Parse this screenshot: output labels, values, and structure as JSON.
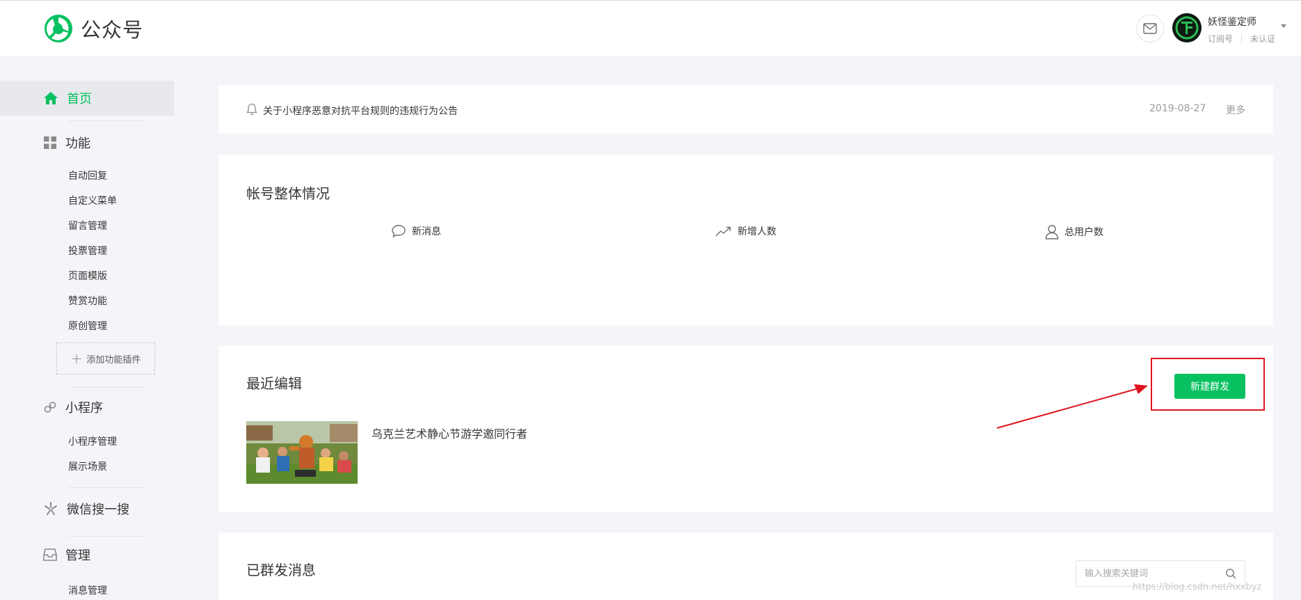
{
  "header": {
    "brand": "公众号",
    "account_name": "妖怪鉴定师",
    "account_type": "订阅号",
    "account_status": "未认证",
    "icons": [
      "brand-logo-icon",
      "mail-icon",
      "avatar",
      "chevron-down-icon"
    ]
  },
  "sidebar": {
    "home": "首页",
    "functions": {
      "label": "功能",
      "items": [
        "自动回复",
        "自定义菜单",
        "留言管理",
        "投票管理",
        "页面模版",
        "赞赏功能",
        "原创管理"
      ]
    },
    "add_plugin": "添加功能插件",
    "miniprogram": {
      "label": "小程序",
      "items": [
        "小程序管理",
        "展示场景"
      ]
    },
    "wechat_search": {
      "label": "微信搜一搜"
    },
    "management": {
      "label": "管理",
      "items": [
        "消息管理"
      ]
    }
  },
  "notice": {
    "text": "关于小程序恶意对抗平台规则的违规行为公告",
    "date": "2019-08-27",
    "more": "更多"
  },
  "overview": {
    "title": "帐号整体情况",
    "stats": [
      "新消息",
      "新增人数",
      "总用户数"
    ]
  },
  "recent": {
    "title": "最近编辑",
    "new_button": "新建群发",
    "article_title": "乌克兰艺术静心节游学邀同行者"
  },
  "sent": {
    "title": "已群发消息",
    "search_placeholder": "输入搜索关键词"
  },
  "watermark": "https://blog.csdn.net/hxxbyz",
  "colors": {
    "brand_green": "#07c160",
    "annotation_red": "#e0141e",
    "page_bg": "#f4f5f9"
  }
}
